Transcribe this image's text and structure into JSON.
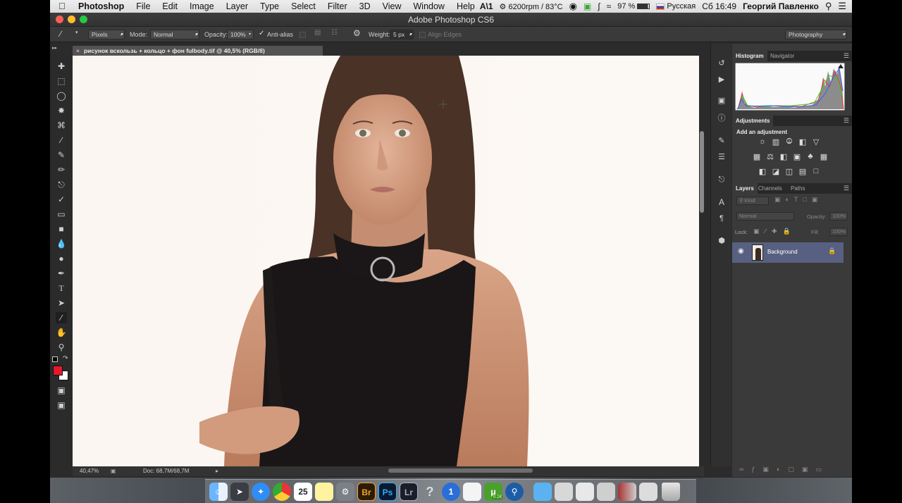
{
  "menubar": {
    "app": "Photoshop",
    "items": [
      "File",
      "Edit",
      "Image",
      "Layer",
      "Type",
      "Select",
      "Filter",
      "3D",
      "View",
      "Window",
      "Help"
    ],
    "status_ai": "1",
    "fan": "6200rpm / 83°C",
    "battery": "97 %",
    "input_source": "Русская",
    "clock": "Сб 16:49",
    "user": "Георгий Павленко"
  },
  "window": {
    "title": "Adobe Photoshop CS6"
  },
  "options": {
    "source_value": "Pixels",
    "mode_label": "Mode:",
    "mode_value": "Normal",
    "opacity_label": "Opacity:",
    "opacity_value": "100%",
    "antialias_label": "Anti-alias",
    "weight_label": "Weight:",
    "weight_value": "5 px",
    "align_edges_label": "Align Edges",
    "workspace": "Photography"
  },
  "document": {
    "tab_title": "рисунок вскользь + кольцо + фон fulbody.tif @ 40,5% (RGB/8)",
    "close_glyph": "×",
    "zoom": "40,47%",
    "doc_size": "Doc: 68,7M/68,7M"
  },
  "panels": {
    "histogram": {
      "tabs": [
        "Histogram",
        "Navigator"
      ]
    },
    "adjustments": {
      "title": "Adjustments",
      "subtitle": "Add an adjustment"
    },
    "layers": {
      "tabs": [
        "Layers",
        "Channels",
        "Paths"
      ],
      "kind": "Kind",
      "blend_mode": "Normal",
      "opacity_label": "Opacity:",
      "opacity_value": "100%",
      "lock_label": "Lock:",
      "fill_label": "Fill:",
      "fill_value": "100%",
      "items": [
        {
          "name": "Background",
          "visible": true,
          "locked": true
        }
      ]
    }
  },
  "dock": {
    "calendar_day": "25",
    "bridge": "Br",
    "photoshop": "Ps",
    "lightroom": "Lr",
    "badge": "0.1K"
  },
  "colors": {
    "foreground": "#e8182c",
    "background": "#ffffff",
    "selection": "#576080"
  }
}
